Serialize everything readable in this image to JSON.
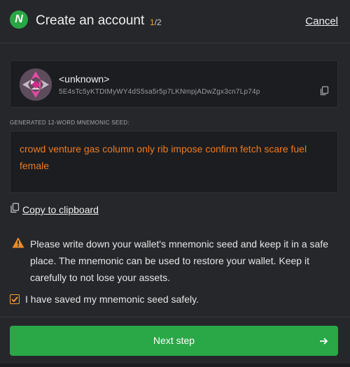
{
  "header": {
    "logo_letter": "N",
    "title": "Create an account",
    "step_current": "1",
    "step_total": "/2",
    "cancel_label": "Cancel"
  },
  "account": {
    "name": "<unknown>",
    "address": "5E4sTc5yKTDtMyWY4dS5sa5r5p7LKNmpjADwZgx3cn7Lp74p",
    "identicon": "identicon-icon",
    "copy_icon": "copy-icon"
  },
  "seed": {
    "label": "GENERATED 12-WORD MNEMONIC SEED:",
    "phrase": "crowd venture gas column only rib impose confirm fetch scare fuel female"
  },
  "copy": {
    "label": "Copy to clipboard",
    "icon": "copy-icon"
  },
  "warning": {
    "icon": "warning-icon",
    "text": "Please write down your wallet's mnemonic seed and keep it in a safe place. The mnemonic can be used to restore your wallet. Keep it carefully to not lose your assets."
  },
  "confirm": {
    "label": "I have saved my mnemonic seed safely.",
    "checked": true
  },
  "footer": {
    "next_label": "Next step",
    "icon": "arrow-right-icon"
  },
  "colors": {
    "background": "#26272b",
    "panel": "#1c1d21",
    "accent_green": "#2aa747",
    "seed_orange": "#f07a1a",
    "step_orange": "#f0a030",
    "warning_orange": "#f08a24"
  }
}
